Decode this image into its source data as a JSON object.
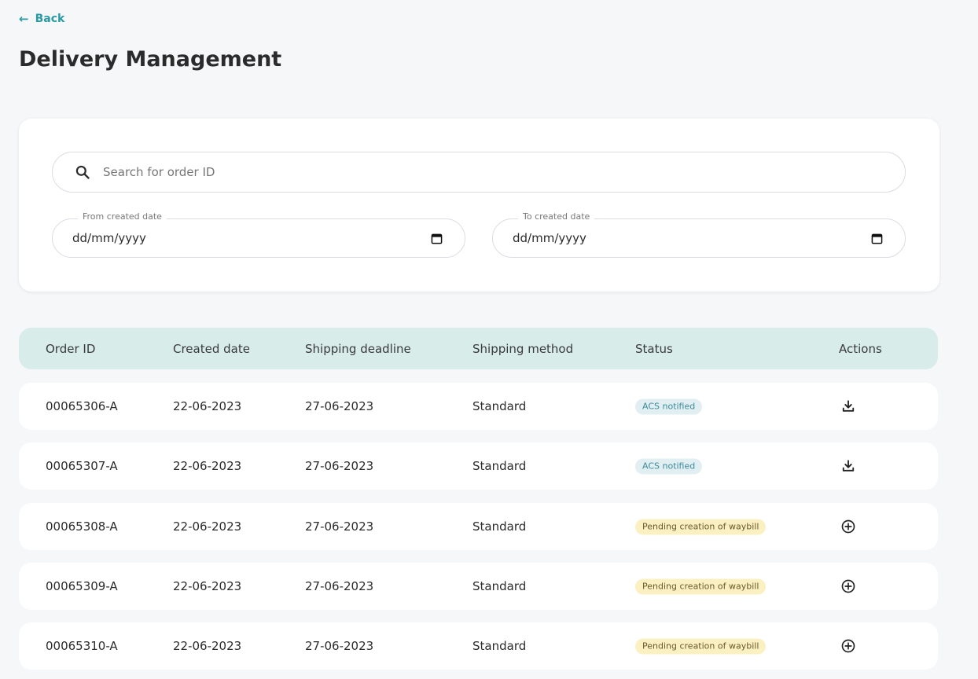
{
  "nav": {
    "back_label": "Back",
    "back_icon": "arrow-left-icon"
  },
  "page": {
    "title": "Delivery Management"
  },
  "filters": {
    "search": {
      "placeholder": "Search for order ID",
      "icon": "search-icon"
    },
    "from_date": {
      "label": "From created date",
      "value": "dd/mm/yyyy",
      "icon": "calendar-icon"
    },
    "to_date": {
      "label": "To created date",
      "value": "dd/mm/yyyy",
      "icon": "calendar-icon"
    }
  },
  "table": {
    "headers": [
      "Order ID",
      "Created date",
      "Shipping deadline",
      "Shipping method",
      "Status",
      "Actions"
    ],
    "rows": [
      {
        "order_id": "00065306-A",
        "created": "22-06-2023",
        "deadline": "27-06-2023",
        "method": "Standard",
        "status": "ACS notified",
        "action_icon": "download-icon"
      },
      {
        "order_id": "00065307-A",
        "created": "22-06-2023",
        "deadline": "27-06-2023",
        "method": "Standard",
        "status": "ACS notified",
        "action_icon": "download-icon"
      },
      {
        "order_id": "00065308-A",
        "created": "22-06-2023",
        "deadline": "27-06-2023",
        "method": "Standard",
        "status": "Pending creation of waybill",
        "action_icon": "add-circle-icon"
      },
      {
        "order_id": "00065309-A",
        "created": "22-06-2023",
        "deadline": "27-06-2023",
        "method": "Standard",
        "status": "Pending creation of waybill",
        "action_icon": "add-circle-icon"
      },
      {
        "order_id": "00065310-A",
        "created": "22-06-2023",
        "deadline": "27-06-2023",
        "method": "Standard",
        "status": "Pending creation of waybill",
        "action_icon": "add-circle-icon"
      }
    ]
  },
  "colors": {
    "accent": "#2a9aa4",
    "header_bg": "#d8ecea",
    "badge_notified_bg": "#e1eff2",
    "badge_pending_bg": "#fbf0c2"
  }
}
